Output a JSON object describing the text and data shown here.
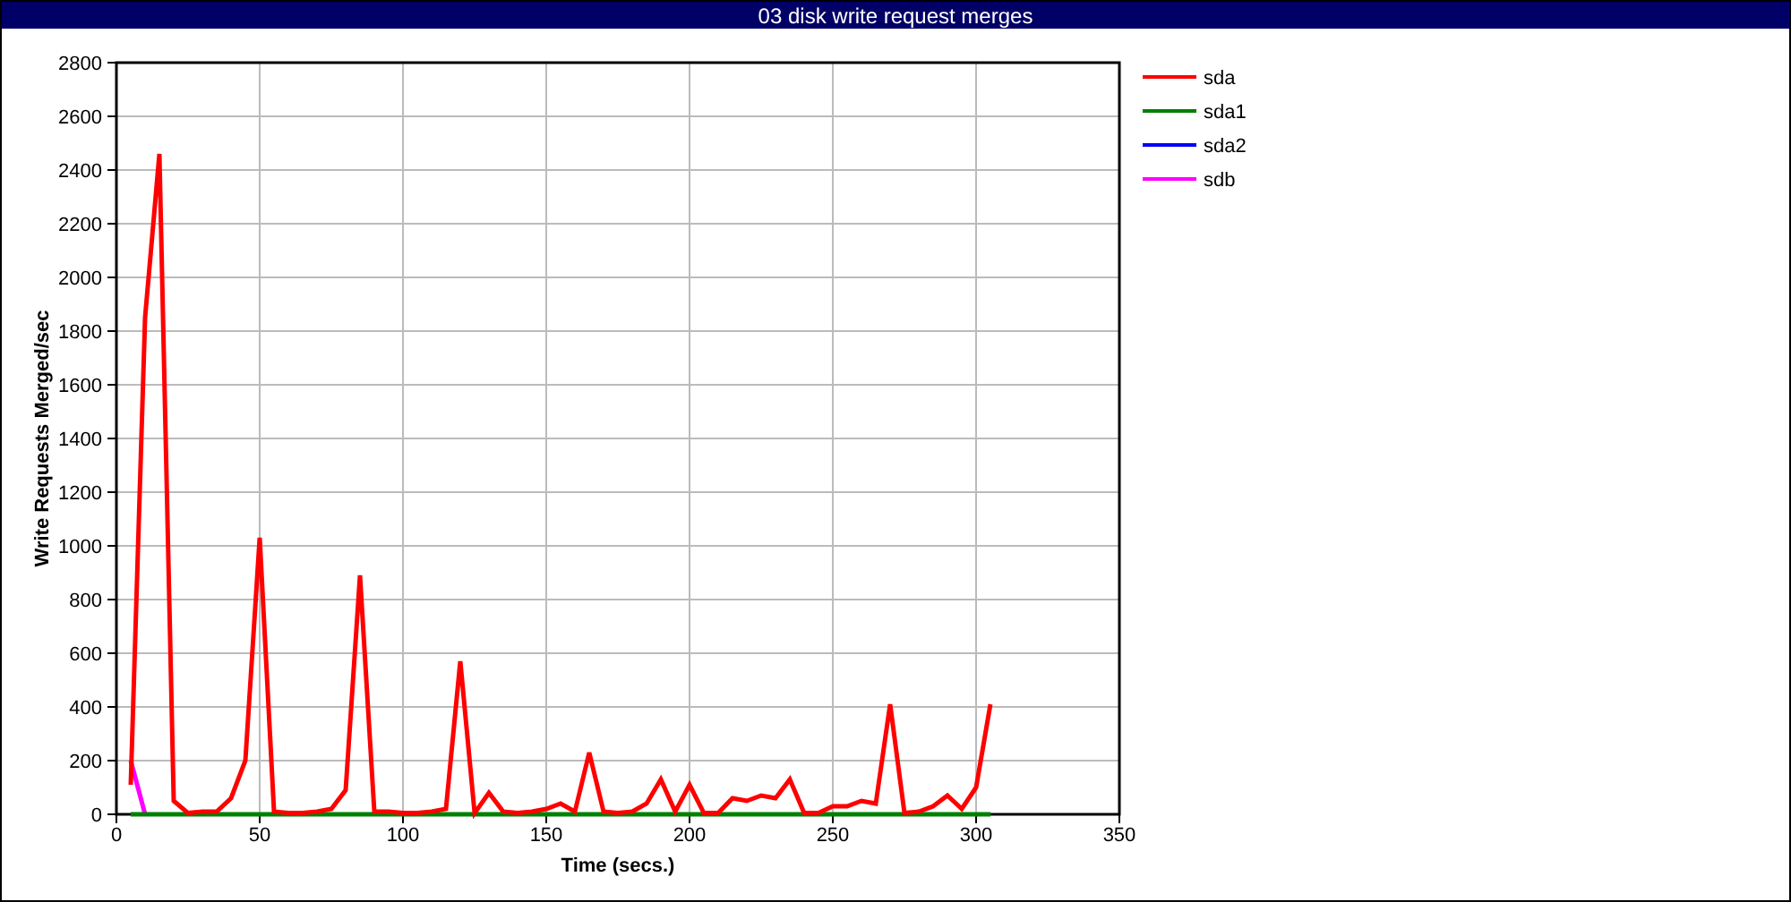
{
  "window": {
    "title": "03 disk write request merges"
  },
  "chart_data": {
    "type": "line",
    "xlabel": "Time (secs.)",
    "ylabel": "Write Requests Merged/sec",
    "xlim": [
      0,
      350
    ],
    "ylim": [
      0,
      2800
    ],
    "xticks": [
      0,
      50,
      100,
      150,
      200,
      250,
      300,
      350
    ],
    "yticks": [
      0,
      200,
      400,
      600,
      800,
      1000,
      1200,
      1400,
      1600,
      1800,
      2000,
      2200,
      2400,
      2600,
      2800
    ],
    "x": [
      5,
      10,
      15,
      20,
      25,
      30,
      35,
      40,
      45,
      50,
      55,
      60,
      65,
      70,
      75,
      80,
      85,
      90,
      95,
      100,
      105,
      110,
      115,
      120,
      125,
      130,
      135,
      140,
      145,
      150,
      155,
      160,
      165,
      170,
      175,
      180,
      185,
      190,
      195,
      200,
      205,
      210,
      215,
      220,
      225,
      230,
      235,
      240,
      245,
      250,
      255,
      260,
      265,
      270,
      275,
      280,
      285,
      290,
      295,
      300,
      305
    ],
    "series": [
      {
        "name": "sda",
        "color": "#ff0000",
        "values": [
          110,
          1850,
          2460,
          50,
          5,
          10,
          10,
          60,
          200,
          1030,
          10,
          5,
          5,
          10,
          20,
          90,
          890,
          10,
          10,
          5,
          5,
          10,
          20,
          570,
          5,
          80,
          10,
          5,
          10,
          20,
          40,
          10,
          230,
          10,
          5,
          10,
          40,
          130,
          10,
          110,
          5,
          5,
          60,
          50,
          70,
          60,
          130,
          5,
          5,
          30,
          30,
          50,
          40,
          410,
          5,
          10,
          30,
          70,
          20,
          100,
          410
        ]
      },
      {
        "name": "sda1",
        "color": "#008000",
        "values": [
          0,
          0,
          0,
          0,
          0,
          0,
          0,
          0,
          0,
          0,
          0,
          0,
          0,
          0,
          0,
          0,
          0,
          0,
          0,
          0,
          0,
          0,
          0,
          0,
          0,
          0,
          0,
          0,
          0,
          0,
          0,
          0,
          0,
          0,
          0,
          0,
          0,
          0,
          0,
          0,
          0,
          0,
          0,
          0,
          0,
          0,
          0,
          0,
          0,
          0,
          0,
          0,
          0,
          0,
          0,
          0,
          0,
          0,
          0,
          0,
          0
        ]
      },
      {
        "name": "sda2",
        "color": "#0000ff",
        "values": [
          null,
          null,
          null,
          null,
          null,
          null,
          null,
          null,
          null,
          null,
          null,
          null,
          null,
          null,
          null,
          null,
          null,
          null,
          null,
          null,
          null,
          null,
          null,
          null,
          null,
          null,
          null,
          null,
          null,
          null,
          null,
          null,
          null,
          null,
          null,
          null,
          null,
          null,
          null,
          null,
          null,
          null,
          null,
          null,
          null,
          null,
          null,
          null,
          null,
          null,
          null,
          null,
          null,
          null,
          null,
          null,
          null,
          null,
          null,
          null,
          null
        ]
      },
      {
        "name": "sdb",
        "color": "#ff00ff",
        "values": [
          200,
          0,
          null,
          null,
          null,
          null,
          null,
          null,
          null,
          null,
          null,
          null,
          null,
          null,
          null,
          null,
          null,
          null,
          null,
          null,
          null,
          null,
          null,
          null,
          null,
          null,
          null,
          null,
          null,
          null,
          null,
          null,
          null,
          null,
          null,
          null,
          null,
          null,
          null,
          null,
          null,
          null,
          null,
          null,
          null,
          null,
          null,
          null,
          null,
          null,
          null,
          null,
          null,
          null,
          null,
          null,
          null,
          null,
          null,
          null,
          null
        ]
      }
    ],
    "grid": true,
    "legend": true
  }
}
